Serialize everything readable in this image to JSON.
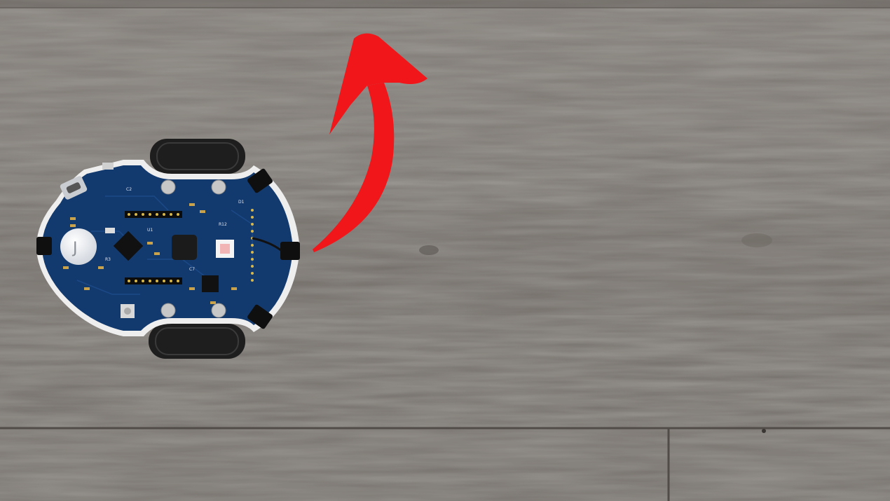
{
  "scene": {
    "subject": "robot-car",
    "surface": "wood-plank-floor",
    "annotation": "curved-arrow"
  },
  "colors": {
    "floor_base": "#7b7672",
    "floor_light": "#8e8a86",
    "floor_dark": "#5f5a56",
    "plank_seam": "#4e4a46",
    "pcb_blue": "#123a6e",
    "pcb_edge": "#f2f2f2",
    "tire": "#1e1e1e",
    "arrow_red": "#f0161a"
  },
  "robot": {
    "board_labels": [
      "J",
      "C2",
      "R3",
      "U1",
      "C7",
      "R12",
      "D1"
    ]
  }
}
